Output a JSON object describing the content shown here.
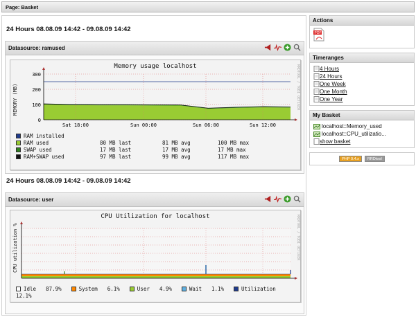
{
  "page_bar": "Page: Basket",
  "sections": [
    {
      "period": "24 Hours 08.08.09 14:42 - 09.08.09 14:42",
      "datasource": "Datasource: ramused",
      "graph_title": "Memory usage localhost",
      "ylabel": "MEMORY (MB)",
      "side_text": "RRDTOOL / TOBI OETIKER",
      "yticks": [
        "300",
        "200",
        "100",
        "0"
      ],
      "xticks": [
        "Sat 18:00",
        "Sun 00:00",
        "Sun 06:00",
        "Sun 12:00"
      ],
      "legend": [
        {
          "name": "RAM installed",
          "last": "",
          "avg": "",
          "max": "",
          "color": "#1f3b8c"
        },
        {
          "name": "RAM used",
          "last": "80 MB last",
          "avg": "81 MB avg",
          "max": "100 MB max",
          "color": "#99cc33"
        },
        {
          "name": "SWAP used",
          "last": "17 MB last",
          "avg": "17 MB avg",
          "max": "17 MB max",
          "color": "#2f7f1f"
        },
        {
          "name": "RAM+SWAP used",
          "last": "97 MB last",
          "avg": "99 MB avg",
          "max": "117 MB max",
          "color": "#111111"
        }
      ]
    },
    {
      "period": "24 Hours 08.08.09 14:42 - 09.08.09 14:42",
      "datasource": "Datasource: user",
      "graph_title": "CPU Utilization for localhost",
      "ylabel": "CPU utilization %",
      "side_text": "RRDTOOL / TOBI OETIKER",
      "legend_line1": [
        {
          "name": "Idle",
          "value": "87.9%",
          "color": "#ffffff"
        },
        {
          "name": "System",
          "value": "6.1%",
          "color": "#ff8800"
        },
        {
          "name": "User",
          "value": "4.9%",
          "color": "#99cc33"
        },
        {
          "name": "Wait",
          "value": "1.1%",
          "color": "#5fb0e0"
        },
        {
          "name": "Utilization",
          "value": "",
          "color": "#1f3b8c"
        }
      ],
      "legend_line2": "12.1%"
    }
  ],
  "sidebar": {
    "actions_title": "Actions",
    "timeranges_title": "Timeranges",
    "timeranges": [
      "4 Hours",
      "24 Hours",
      "One Week",
      "One Month",
      "One Year"
    ],
    "basket_title": "My Basket",
    "basket_items": [
      "localhost::Memory_used",
      "localhost::CPU_utilizatio..."
    ],
    "show_basket": "show basket",
    "badges": [
      "PHP 0.4.x",
      "RRDtool"
    ]
  },
  "chart_data": [
    {
      "type": "area",
      "title": "Memory usage localhost",
      "ylabel": "MEMORY (MB)",
      "ylim": [
        0,
        300
      ],
      "x_ticks": [
        "Sat 18:00",
        "Sun 00:00",
        "Sun 06:00",
        "Sun 12:00"
      ],
      "series": [
        {
          "name": "RAM installed",
          "values": [
            250,
            250,
            250,
            250,
            250,
            250,
            250,
            250,
            250,
            250
          ]
        },
        {
          "name": "RAM used",
          "values": [
            100,
            96,
            95,
            95,
            94,
            93,
            72,
            78,
            82,
            80
          ]
        },
        {
          "name": "SWAP used",
          "values": [
            17,
            17,
            17,
            17,
            17,
            17,
            17,
            17,
            17,
            17
          ]
        }
      ]
    },
    {
      "type": "area",
      "title": "CPU Utilization for localhost",
      "ylabel": "CPU utilization %",
      "series": [
        {
          "name": "System",
          "values": [
            6,
            6,
            6,
            6,
            6,
            6,
            6,
            6,
            6,
            6
          ]
        },
        {
          "name": "User",
          "values": [
            5,
            5,
            5,
            5,
            5,
            5,
            5,
            5,
            5,
            5
          ]
        },
        {
          "name": "Wait",
          "values": [
            1,
            1,
            1,
            1,
            1,
            1,
            1,
            1,
            1,
            1
          ]
        }
      ]
    }
  ]
}
